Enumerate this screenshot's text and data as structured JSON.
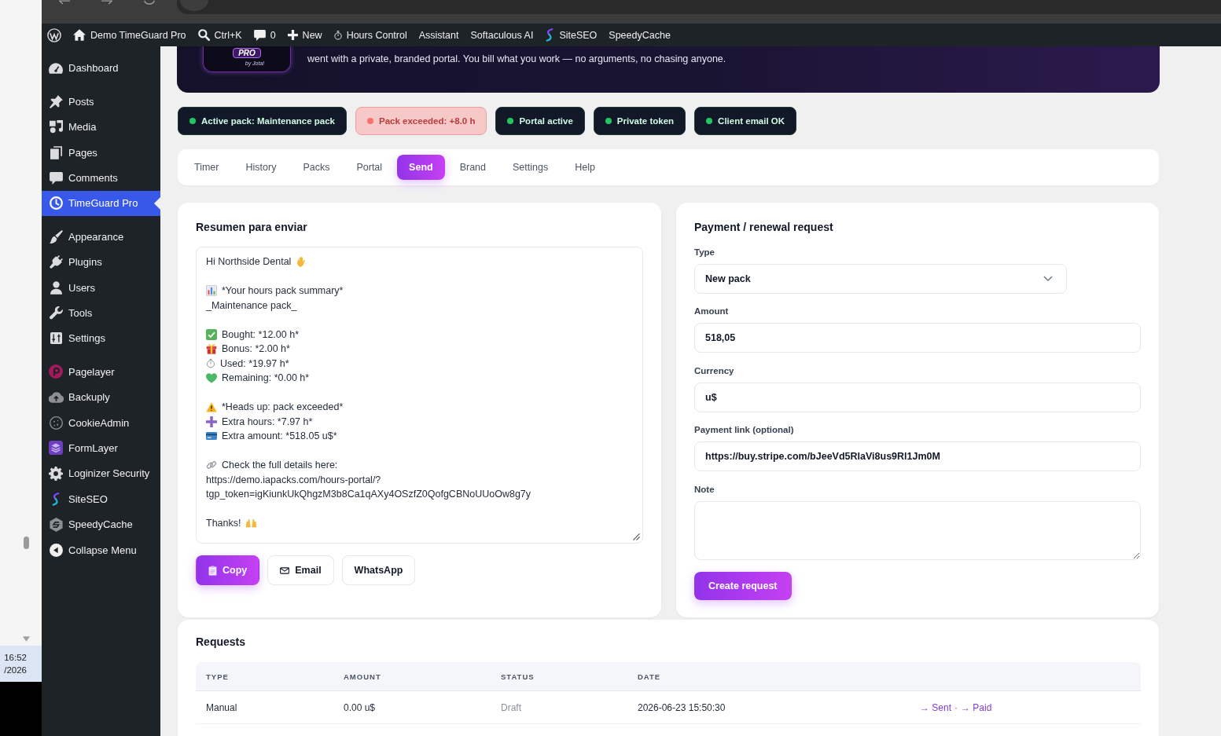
{
  "desktop_strip": {
    "time": "16:52",
    "date": "/2026"
  },
  "admin_bar": {
    "items": [
      {
        "label": "Demo TimeGuard Pro"
      },
      {
        "label": "Ctrl+K"
      },
      {
        "label": "0"
      },
      {
        "label": "New"
      },
      {
        "label": "Hours Control"
      },
      {
        "label": "Assistant"
      },
      {
        "label": "Softaculous AI"
      },
      {
        "label": "SiteSEO"
      },
      {
        "label": "SpeedyCache"
      }
    ]
  },
  "sidebar": {
    "groups": [
      [
        {
          "label": "Dashboard",
          "selected": false
        }
      ],
      [
        {
          "label": "Posts",
          "selected": false
        },
        {
          "label": "Media",
          "selected": false
        },
        {
          "label": "Pages",
          "selected": false
        },
        {
          "label": "Comments",
          "selected": false
        },
        {
          "label": "TimeGuard Pro",
          "selected": true
        }
      ],
      [
        {
          "label": "Appearance",
          "selected": false
        },
        {
          "label": "Plugins",
          "selected": false
        },
        {
          "label": "Users",
          "selected": false
        },
        {
          "label": "Tools",
          "selected": false
        },
        {
          "label": "Settings",
          "selected": false
        }
      ],
      [
        {
          "label": "Pagelayer",
          "selected": false
        },
        {
          "label": "Backuply",
          "selected": false
        },
        {
          "label": "CookieAdmin",
          "selected": false
        },
        {
          "label": "FormLayer",
          "selected": false
        },
        {
          "label": "Loginizer Security",
          "selected": false
        },
        {
          "label": "SiteSEO",
          "selected": false
        },
        {
          "label": "SpeedyCache",
          "selected": false
        }
      ]
    ],
    "collapse_label": "Collapse Menu"
  },
  "hero": {
    "logo_tag": "PRO",
    "logo_byline": "by Jota!",
    "text": "went with a private, branded portal. You bill what you work — no arguments, no chasing anyone."
  },
  "status_badges": [
    {
      "label": "Active pack: Maintenance pack",
      "kind": "ok"
    },
    {
      "label": "Pack exceeded: +8.0 h",
      "kind": "alert"
    },
    {
      "label": "Portal active",
      "kind": "ok"
    },
    {
      "label": "Private token",
      "kind": "ok"
    },
    {
      "label": "Client email OK",
      "kind": "ok"
    }
  ],
  "tabs": [
    {
      "label": "Timer",
      "selected": false
    },
    {
      "label": "History",
      "selected": false
    },
    {
      "label": "Packs",
      "selected": false
    },
    {
      "label": "Portal",
      "selected": false
    },
    {
      "label": "Send",
      "selected": true
    },
    {
      "label": "Brand",
      "selected": false
    },
    {
      "label": "Settings",
      "selected": false
    },
    {
      "label": "Help",
      "selected": false
    }
  ],
  "summary_card": {
    "title": "Resumen para enviar",
    "message": [
      [
        {
          "kind": "greeting",
          "text": "Hi Northside Dental"
        }
      ],
      [
        {
          "kind": "title",
          "text": "*Your hours pack summary*"
        },
        {
          "kind": "subtitle",
          "text": "_Maintenance pack_"
        }
      ],
      [
        {
          "kind": "bought",
          "text": "Bought: *12.00 h*"
        },
        {
          "kind": "bonus",
          "text": "Bonus: *2.00 h*"
        },
        {
          "kind": "used",
          "text": "Used: *19.97 h*"
        },
        {
          "kind": "remaining",
          "text": "Remaining: *0.00 h*"
        }
      ],
      [
        {
          "kind": "alert",
          "text": "*Heads up: pack exceeded*"
        },
        {
          "kind": "hours",
          "text": "Extra hours: *7.97 h*"
        },
        {
          "kind": "amount",
          "text": "Extra amount: *518.05 u$*"
        }
      ],
      [
        {
          "kind": "link",
          "text": "Check the full details here:"
        },
        {
          "kind": "url",
          "text": "https://demo.iapacks.com/hours-portal/?"
        },
        {
          "kind": "url",
          "text": "tgp_token=igKiunkUkQhgzM3b8Ca1qAXy4OSzfZ0QofgCBNoUUoOw8g7y"
        }
      ],
      [
        {
          "kind": "closing",
          "text": "Thanks!"
        }
      ]
    ],
    "buttons": [
      {
        "label": "Copy",
        "kind": "copy"
      },
      {
        "label": "Email",
        "kind": "email"
      },
      {
        "label": "WhatsApp",
        "kind": "plain"
      }
    ]
  },
  "request_form": {
    "title": "Payment / renewal request",
    "type": {
      "label": "Type",
      "value": "New pack"
    },
    "amount": {
      "label": "Amount",
      "value": "518,05"
    },
    "currency": {
      "label": "Currency",
      "value": "u$"
    },
    "payment_link": {
      "label": "Payment link (optional)",
      "value": "https://buy.stripe.com/bJeeVd5RlaVi8us9Rl1Jm0M"
    },
    "note": {
      "label": "Note"
    },
    "submit": "Create request"
  },
  "requests": {
    "title": "Requests",
    "columns": [
      "TYPE",
      "AMOUNT",
      "STATUS",
      "DATE"
    ],
    "action_separator": "·",
    "rows": [
      {
        "type": "Manual",
        "amount": "0.00 u$",
        "status": "Draft",
        "date": "2026-06-23 15:50:30",
        "actions": [
          "→ Sent",
          "→ Paid"
        ]
      }
    ]
  }
}
